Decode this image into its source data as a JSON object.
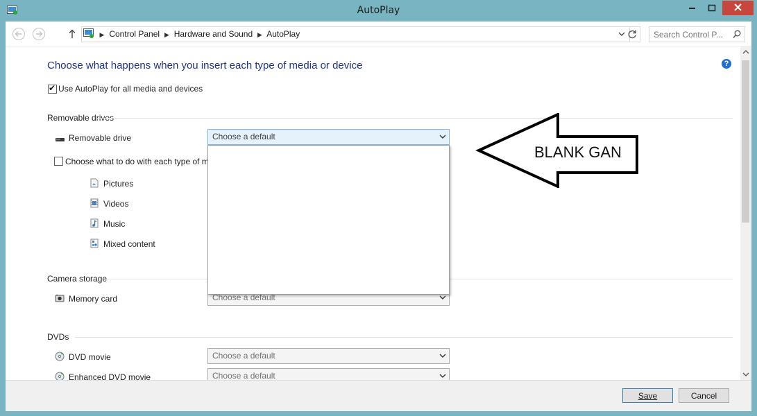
{
  "window": {
    "title": "AutoPlay"
  },
  "breadcrumb": [
    "Control Panel",
    "Hardware and Sound",
    "AutoPlay"
  ],
  "search": {
    "placeholder": "Search Control P..."
  },
  "heading": "Choose what happens when you insert each type of media or device",
  "use_autoplay": {
    "label": "Use AutoPlay for all media and devices",
    "checked": true
  },
  "removable": {
    "section": "Removable drives",
    "drive_label": "Removable drive",
    "drive_value": "Choose a default",
    "choose_each": {
      "label": "Choose what to do with each type of m",
      "checked": false
    },
    "media_types": [
      "Pictures",
      "Videos",
      "Music",
      "Mixed content"
    ]
  },
  "camera": {
    "section": "Camera storage",
    "memory_card": "Memory card",
    "value": "Choose a default"
  },
  "dvds": {
    "section": "DVDs",
    "dvd_movie": "DVD movie",
    "dvd_value": "Choose a default",
    "enhanced": "Enhanced DVD movie",
    "enhanced_value": "Choose a default"
  },
  "annotation": "BLANK GAN",
  "footer": {
    "save": "Save",
    "cancel": "Cancel"
  },
  "colors": {
    "heading": "#1e3287",
    "help": "#1f6fd1",
    "close": "#c7473d",
    "frame": "#78b4c2"
  }
}
